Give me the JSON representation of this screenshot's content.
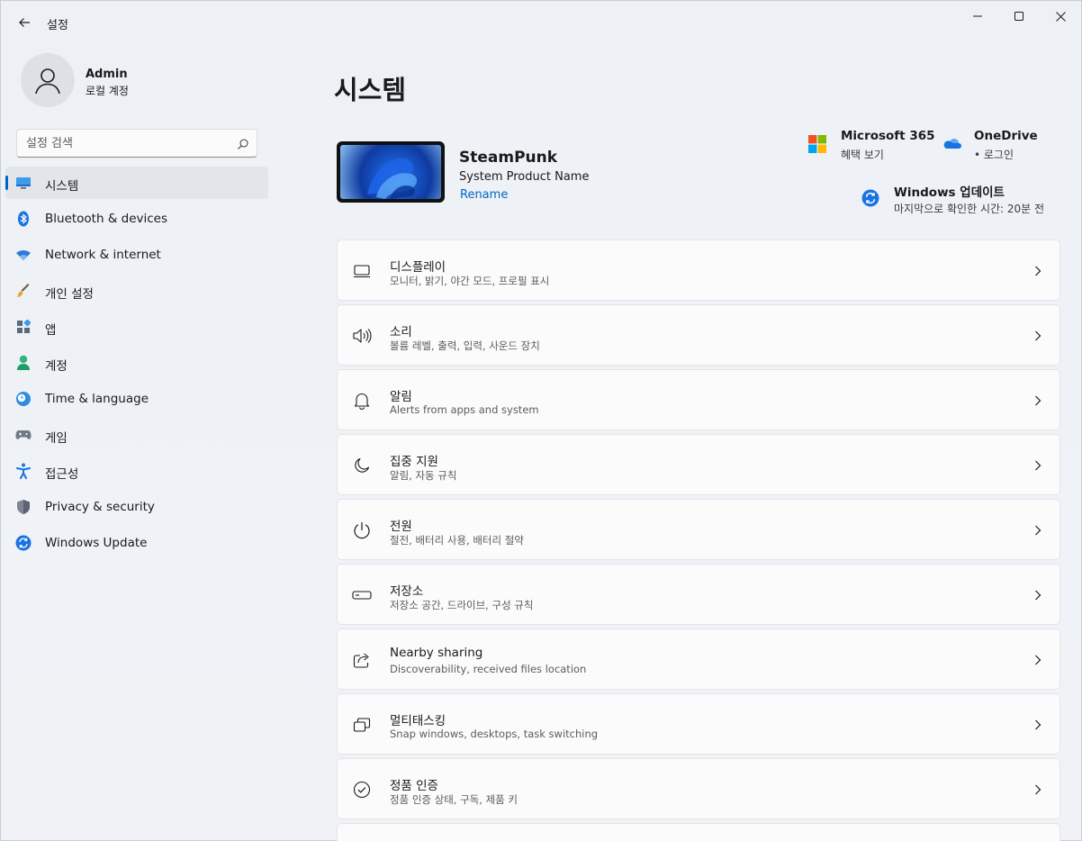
{
  "app": {
    "title": "설정"
  },
  "profile": {
    "name": "Admin",
    "account_type": "로컬 계정"
  },
  "search": {
    "placeholder": "설정 검색"
  },
  "sidebar": {
    "items": [
      {
        "label": "시스템",
        "icon": "monitor-icon",
        "active": true
      },
      {
        "label": "Bluetooth & devices",
        "icon": "bluetooth-icon"
      },
      {
        "label": "Network & internet",
        "icon": "wifi-icon"
      },
      {
        "label": "개인 설정",
        "icon": "brush-icon"
      },
      {
        "label": "앱",
        "icon": "apps-icon"
      },
      {
        "label": "계정",
        "icon": "person-icon"
      },
      {
        "label": "Time & language",
        "icon": "globe-clock-icon"
      },
      {
        "label": "게임",
        "icon": "gamepad-icon"
      },
      {
        "label": "접근성",
        "icon": "accessibility-icon"
      },
      {
        "label": "Privacy & security",
        "icon": "shield-icon"
      },
      {
        "label": "Windows Update",
        "icon": "update-icon"
      }
    ]
  },
  "main": {
    "title": "시스템",
    "device": {
      "name": "SteamPunk",
      "model": "System Product Name",
      "rename_label": "Rename"
    },
    "quick_links": {
      "m365": {
        "title": "Microsoft 365",
        "sub": "혜택 보기"
      },
      "onedrive": {
        "title": "OneDrive",
        "sub": "• 로그인"
      },
      "update": {
        "title": "Windows 업데이트",
        "sub": "마지막으로 확인한 시간: 20분 전"
      }
    },
    "cards": [
      {
        "title": "디스플레이",
        "sub": "모니터, 밝기, 야간 모드, 프로필 표시",
        "icon": "display-icon"
      },
      {
        "title": "소리",
        "sub": "볼륨 레벨, 출력, 입력, 사운드 장치",
        "icon": "speaker-icon"
      },
      {
        "title": "알림",
        "sub": "Alerts from apps and system",
        "icon": "bell-icon"
      },
      {
        "title": "집중 지원",
        "sub": "알림, 자동 규칙",
        "icon": "moon-icon"
      },
      {
        "title": "전원",
        "sub": "절전, 배터리 사용, 배터리 절약",
        "icon": "power-icon"
      },
      {
        "title": "저장소",
        "sub": "저장소 공간, 드라이브, 구성 규칙",
        "icon": "storage-icon"
      },
      {
        "title": "Nearby sharing",
        "sub": "Discoverability, received files location",
        "icon": "share-icon"
      },
      {
        "title": "멀티태스킹",
        "sub": "Snap windows, desktops, task switching",
        "icon": "multitask-icon"
      },
      {
        "title": "정품 인증",
        "sub": "정품 인증 상태, 구독, 제품 키",
        "icon": "check-circle-icon"
      }
    ]
  },
  "colors": {
    "accent": "#0067c0",
    "background": "#eef2f7",
    "card": "#fbfbfc"
  }
}
